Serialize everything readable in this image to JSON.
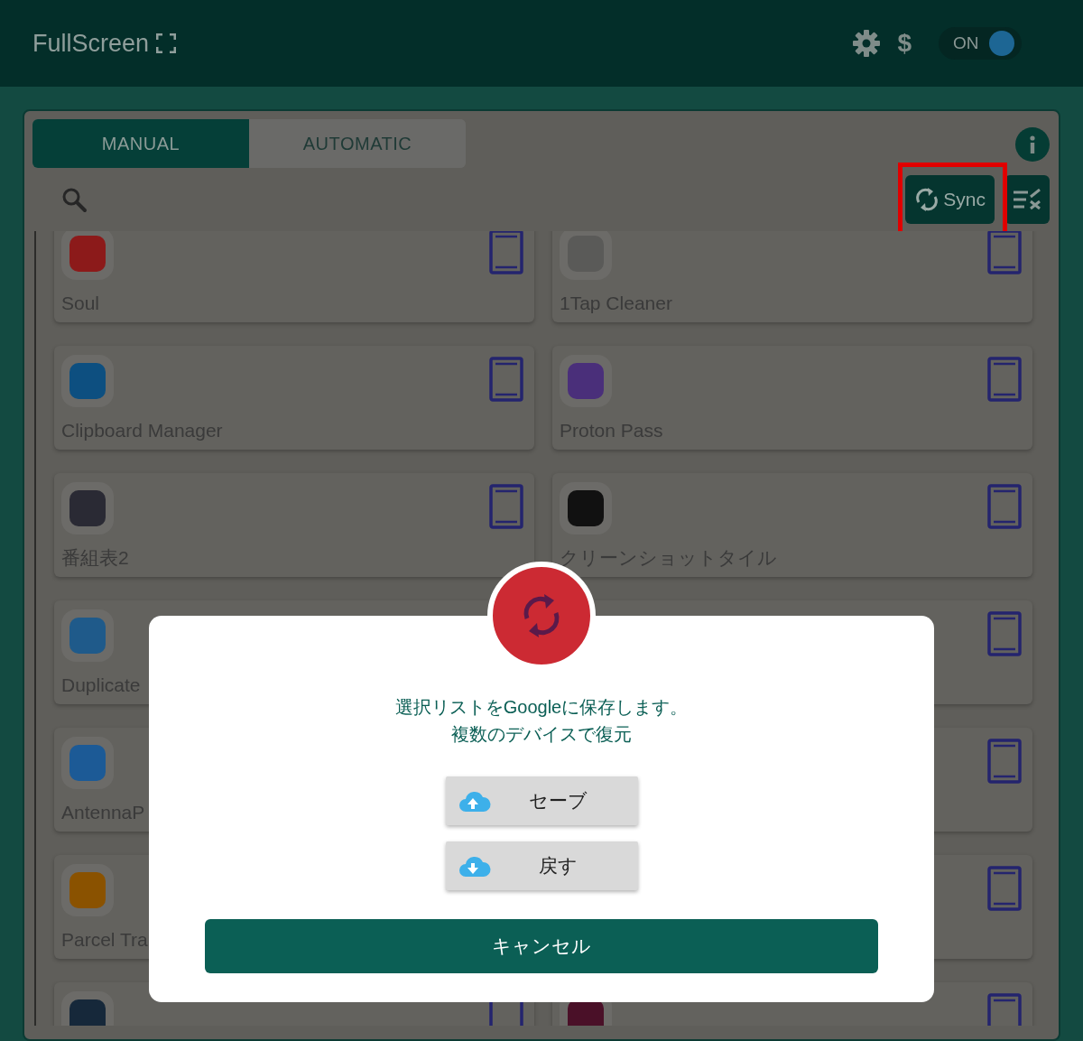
{
  "app": {
    "title": "FullScreen"
  },
  "header": {
    "currency": "$",
    "toggle": {
      "label": "ON",
      "on": true
    }
  },
  "tabs": [
    {
      "label": "MANUAL",
      "selected": true
    },
    {
      "label": "AUTOMATIC",
      "selected": false
    }
  ],
  "toolbar": {
    "sync": {
      "label": "Sync",
      "highlighted": true
    }
  },
  "apps": [
    {
      "kind": "app",
      "name": "Soul",
      "color": "#8c1a1a"
    },
    {
      "kind": "app",
      "name": "1Tap Cleaner",
      "color": "#5a5a58"
    },
    {
      "kind": "app",
      "name": "Clipboard Manager",
      "color": "#0d4f80"
    },
    {
      "kind": "app",
      "name": "Proton Pass",
      "color": "#4a2f7a"
    },
    {
      "kind": "app",
      "name": "番組表2",
      "color": "#2a2a34"
    },
    {
      "kind": "app",
      "name": "クリーンショットタイル",
      "color": "#111111"
    },
    {
      "kind": "app",
      "name": "Duplicate",
      "color": "#1f5a8a"
    },
    {
      "kind": "covered"
    },
    {
      "kind": "app",
      "name": "AntennaP",
      "color": "#1c5a96"
    },
    {
      "kind": "covered"
    },
    {
      "kind": "app",
      "name": "Parcel Tra",
      "color": "#8a5200"
    },
    {
      "kind": "covered"
    },
    {
      "kind": "app",
      "color": "#16283a"
    },
    {
      "kind": "app",
      "color": "#4a1028"
    }
  ],
  "dialog": {
    "message": [
      "選択リストをGoogleに保存します。",
      "複数のデバイスで復元"
    ],
    "buttons": [
      {
        "label": "セーブ",
        "kind": "upload"
      },
      {
        "label": "戻す",
        "kind": "download"
      }
    ],
    "cancel": "キャンセル"
  }
}
